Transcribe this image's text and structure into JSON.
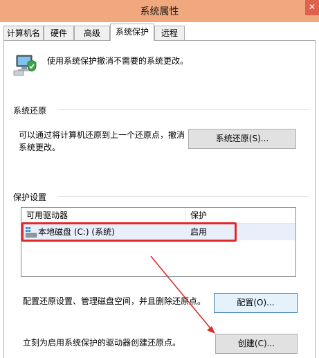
{
  "window": {
    "title": "系统属性",
    "close_glyph": "✕"
  },
  "tabs": [
    {
      "label": "计算机名"
    },
    {
      "label": "硬件"
    },
    {
      "label": "高级"
    },
    {
      "label": "系统保护",
      "active": true
    },
    {
      "label": "远程"
    }
  ],
  "intro": {
    "text": "使用系统保护撤消不需要的系统更改。",
    "icon": "computer-shield-icon"
  },
  "restore": {
    "group_label": "系统还原",
    "description_line1": "可以通过将计算机还原到上一个还原点，撤消",
    "description_line2": "系统更改。",
    "button_label": "系统还原(S)..."
  },
  "protection": {
    "group_label": "保护设置",
    "columns": [
      "可用驱动器",
      "保护"
    ],
    "rows": [
      {
        "drive": "本地磁盘 (C:) (系统)",
        "status": "启用",
        "icon": "drive-icon"
      }
    ]
  },
  "configure": {
    "text": "配置还原设置、管理磁盘空间，并且删除还原点。",
    "button_label": "配置(O)..."
  },
  "create": {
    "text": "立刻为启用系统保护的驱动器创建还原点。",
    "button_label": "创建(C)..."
  },
  "annotations": {
    "highlight_color": "#e02a2a",
    "arrow_color": "#e02a2a"
  }
}
